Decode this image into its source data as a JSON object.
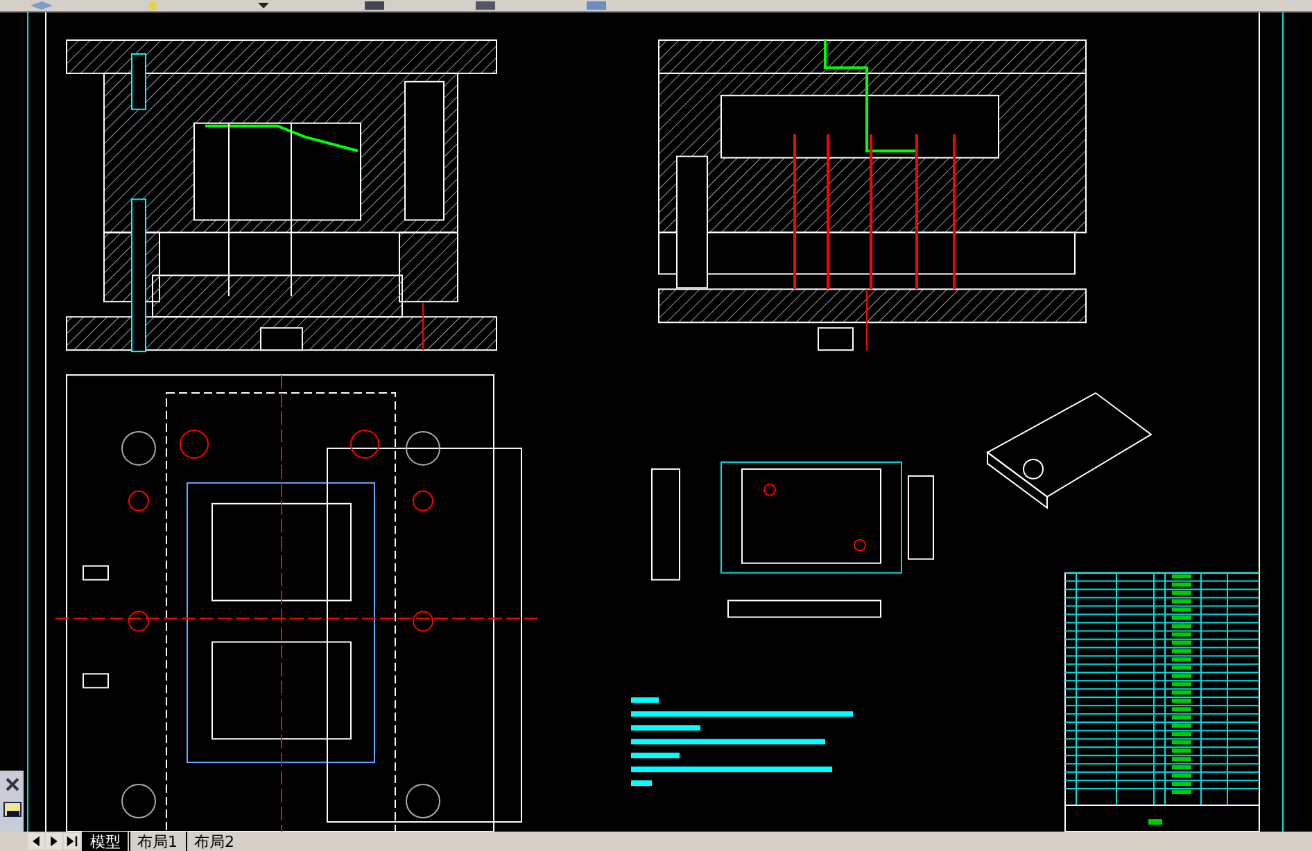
{
  "tabs": [
    {
      "label": "模型",
      "selected": true
    },
    {
      "label": "布局1",
      "selected": false
    },
    {
      "label": "布局2",
      "selected": false
    }
  ]
}
